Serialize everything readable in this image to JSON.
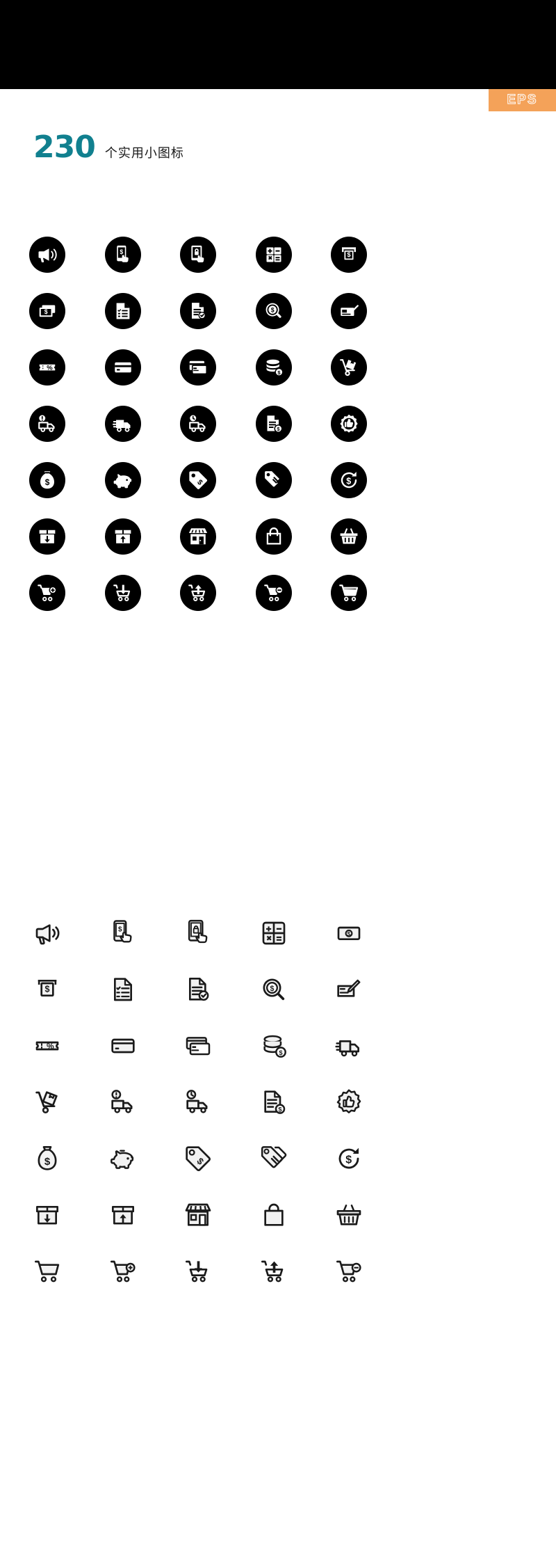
{
  "banner": {
    "background_color": "#000000"
  },
  "badge": {
    "label": "EPS",
    "background_color": "#f4a259",
    "text_color": "#ffffff"
  },
  "title": {
    "count": "230",
    "count_color": "#11808f",
    "label": "个实用小图标",
    "label_color": "#1a1a1a"
  },
  "sections": [
    {
      "style": "solid",
      "fill_color": "#000000",
      "icon_color": "#ffffff",
      "rows": [
        [
          {
            "name": "megaphone-icon",
            "label": "Megaphone Announcement"
          },
          {
            "name": "mobile-payment-tap-icon",
            "label": "Mobile Payment Tap"
          },
          {
            "name": "mobile-secure-payment-icon",
            "label": "Mobile Secure Payment"
          },
          {
            "name": "calculator-icon",
            "label": "Calculator"
          },
          {
            "name": "atm-cash-withdraw-icon",
            "label": "ATM Cash Withdraw"
          }
        ],
        [
          {
            "name": "banknotes-icon",
            "label": "Banknotes Cash"
          },
          {
            "name": "invoice-list-icon",
            "label": "Invoice Checklist"
          },
          {
            "name": "document-verified-icon",
            "label": "Document Verified"
          },
          {
            "name": "money-search-icon",
            "label": "Money Search"
          },
          {
            "name": "cheque-sign-icon",
            "label": "Cheque Signature"
          }
        ],
        [
          {
            "name": "discount-coupon-icon",
            "label": "Discount Coupon Percent"
          },
          {
            "name": "credit-card-icon",
            "label": "Credit Card"
          },
          {
            "name": "multiple-cards-icon",
            "label": "Multiple Payment Cards"
          },
          {
            "name": "coin-stack-dollar-icon",
            "label": "Coin Stack Dollar"
          },
          {
            "name": "hand-truck-box-icon",
            "label": "Hand Truck Delivery"
          }
        ],
        [
          {
            "name": "truck-alert-icon",
            "label": "Delivery Truck Alert"
          },
          {
            "name": "truck-fast-icon",
            "label": "Fast Delivery Truck"
          },
          {
            "name": "truck-time-icon",
            "label": "Scheduled Delivery Truck"
          },
          {
            "name": "invoice-dollar-icon",
            "label": "Invoice Dollar"
          },
          {
            "name": "quality-badge-thumbsup-icon",
            "label": "Quality Badge Thumbs Up"
          }
        ],
        [
          {
            "name": "money-bag-icon",
            "label": "Money Bag"
          },
          {
            "name": "piggy-bank-icon",
            "label": "Piggy Bank"
          },
          {
            "name": "price-tag-dollar-icon",
            "label": "Price Tag Dollar"
          },
          {
            "name": "sale-tags-icon",
            "label": "Sale Tags"
          },
          {
            "name": "refund-dollar-icon",
            "label": "Refund Dollar"
          }
        ],
        [
          {
            "name": "box-inbound-icon",
            "label": "Box Inbound"
          },
          {
            "name": "box-outbound-icon",
            "label": "Box Outbound"
          },
          {
            "name": "storefront-icon",
            "label": "Storefront Shop"
          },
          {
            "name": "shopping-bag-icon",
            "label": "Shopping Bag"
          },
          {
            "name": "shopping-basket-icon",
            "label": "Shopping Basket"
          }
        ],
        [
          {
            "name": "cart-add-icon",
            "label": "Cart Add Item"
          },
          {
            "name": "cart-download-icon",
            "label": "Cart Download"
          },
          {
            "name": "cart-upload-icon",
            "label": "Cart Upload"
          },
          {
            "name": "cart-remove-icon",
            "label": "Cart Remove Item"
          },
          {
            "name": "cart-empty-icon",
            "label": "Shopping Cart"
          }
        ]
      ]
    },
    {
      "style": "outline",
      "stroke_color": "#1a1a1a",
      "rows": [
        [
          {
            "name": "megaphone-icon",
            "label": "Megaphone Announcement"
          },
          {
            "name": "mobile-payment-tap-icon",
            "label": "Mobile Payment Tap"
          },
          {
            "name": "mobile-secure-payment-icon",
            "label": "Mobile Secure Payment"
          },
          {
            "name": "calculator-icon",
            "label": "Calculator"
          },
          {
            "name": "banknote-dollar-icon",
            "label": "Banknote Dollar"
          }
        ],
        [
          {
            "name": "atm-cash-withdraw-icon",
            "label": "ATM Cash Withdraw"
          },
          {
            "name": "invoice-list-icon",
            "label": "Invoice Checklist"
          },
          {
            "name": "document-verified-icon",
            "label": "Document Verified"
          },
          {
            "name": "money-search-icon",
            "label": "Money Search"
          },
          {
            "name": "cheque-sign-icon",
            "label": "Cheque Signature"
          }
        ],
        [
          {
            "name": "discount-coupon-icon",
            "label": "Discount Coupon Percent"
          },
          {
            "name": "credit-card-icon",
            "label": "Credit Card"
          },
          {
            "name": "multiple-cards-icon",
            "label": "Multiple Payment Cards"
          },
          {
            "name": "coin-stack-dollar-icon",
            "label": "Coin Stack Dollar"
          },
          {
            "name": "truck-fast-icon",
            "label": "Fast Delivery Truck"
          }
        ],
        [
          {
            "name": "hand-truck-box-icon",
            "label": "Hand Truck Delivery"
          },
          {
            "name": "truck-alert-icon",
            "label": "Delivery Truck Alert"
          },
          {
            "name": "truck-time-icon",
            "label": "Scheduled Delivery Truck"
          },
          {
            "name": "invoice-dollar-icon",
            "label": "Invoice Dollar"
          },
          {
            "name": "quality-badge-thumbsup-icon",
            "label": "Quality Badge Thumbs Up"
          }
        ],
        [
          {
            "name": "money-bag-icon",
            "label": "Money Bag"
          },
          {
            "name": "piggy-bank-icon",
            "label": "Piggy Bank"
          },
          {
            "name": "price-tag-dollar-icon",
            "label": "Price Tag Dollar"
          },
          {
            "name": "sale-tags-icon",
            "label": "Sale Tags"
          },
          {
            "name": "refund-dollar-icon",
            "label": "Refund Dollar"
          }
        ],
        [
          {
            "name": "box-inbound-icon",
            "label": "Box Inbound"
          },
          {
            "name": "box-outbound-icon",
            "label": "Box Outbound"
          },
          {
            "name": "storefront-icon",
            "label": "Storefront Shop"
          },
          {
            "name": "shopping-bag-icon",
            "label": "Shopping Bag"
          },
          {
            "name": "shopping-basket-icon",
            "label": "Shopping Basket"
          }
        ],
        [
          {
            "name": "cart-empty-icon",
            "label": "Shopping Cart"
          },
          {
            "name": "cart-add-icon",
            "label": "Cart Add Item"
          },
          {
            "name": "cart-download-icon",
            "label": "Cart Download"
          },
          {
            "name": "cart-upload-icon",
            "label": "Cart Upload"
          },
          {
            "name": "cart-remove-icon",
            "label": "Cart Remove Item"
          }
        ]
      ]
    }
  ]
}
